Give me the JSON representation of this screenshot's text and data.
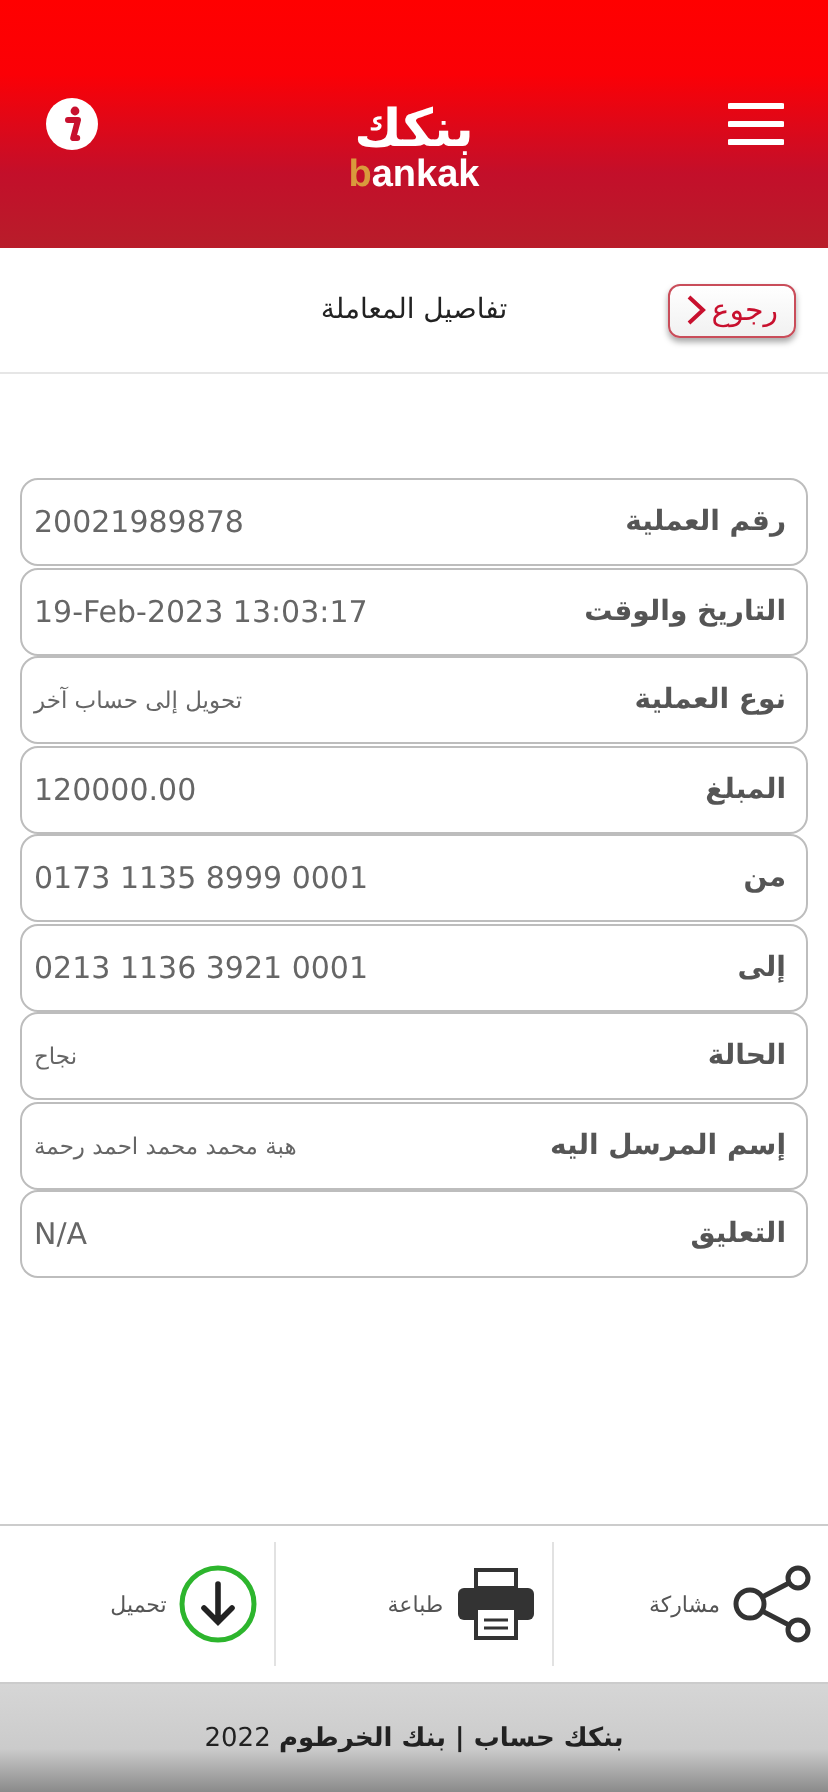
{
  "header": {
    "logo": {
      "arabic": "بنكك",
      "latin_lead": "b",
      "latin_rest": "ankak"
    }
  },
  "title_bar": {
    "title": "تفاصيل المعاملة",
    "back_button": "رجوع"
  },
  "details": [
    {
      "label": "رقم العملية",
      "value": "20021989878",
      "kind": "number"
    },
    {
      "label": "التاريخ والوقت",
      "value": "19-Feb-2023 13:03:17",
      "kind": "number"
    },
    {
      "label": "نوع العملية",
      "value": "تحويل إلى حساب آخر",
      "kind": "text"
    },
    {
      "label": "المبلغ",
      "value": "120000.00",
      "kind": "number"
    },
    {
      "label": "من",
      "value": "0173 1135 8999 0001",
      "kind": "number"
    },
    {
      "label": "إلى",
      "value": "0213 1136 3921 0001",
      "kind": "number"
    },
    {
      "label": "الحالة",
      "value": "نجاح",
      "kind": "text"
    },
    {
      "label": "إسم المرسل اليه",
      "value": "هبة محمد محمد احمد رحمة",
      "kind": "text"
    },
    {
      "label": "التعليق",
      "value": "N/A",
      "kind": "number"
    }
  ],
  "actions": [
    {
      "label": "مشاركة",
      "kind": "share"
    },
    {
      "label": "طباعة",
      "kind": "print"
    },
    {
      "label": "تحميل",
      "kind": "download"
    }
  ],
  "footer": {
    "text": "**بنكك حساب | بنك الخرطوم** 2022"
  }
}
